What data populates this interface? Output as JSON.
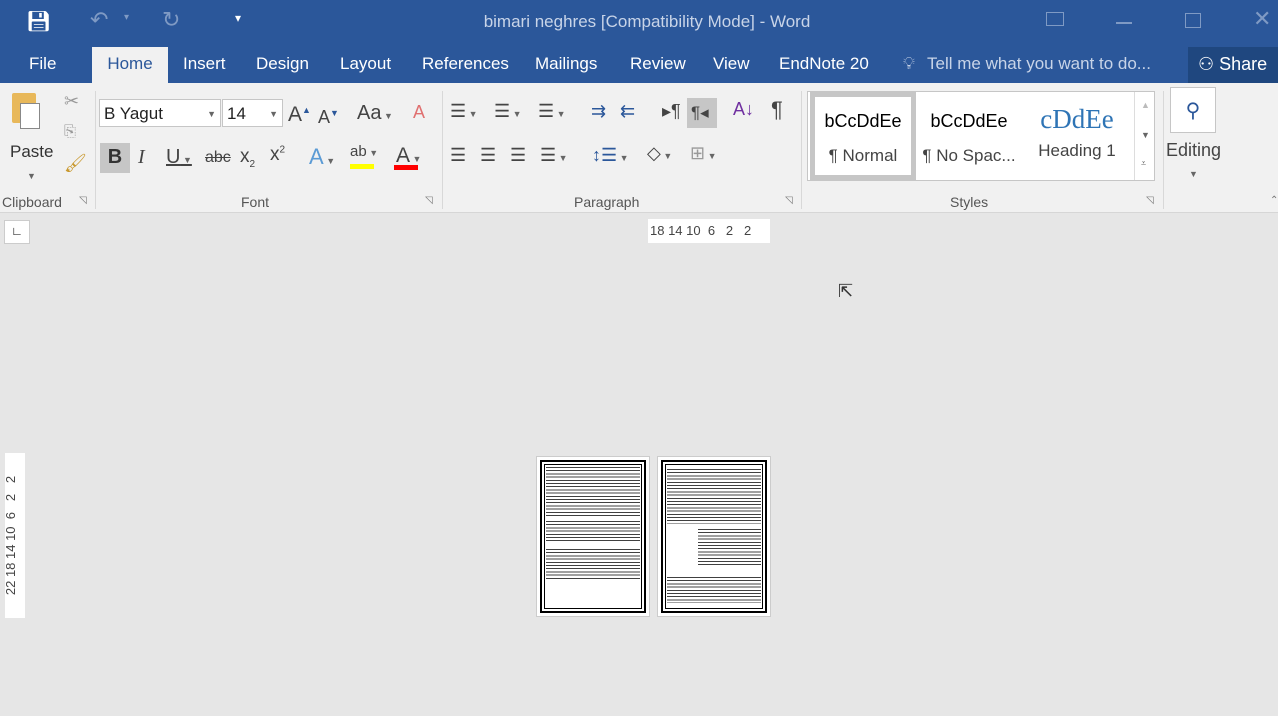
{
  "window": {
    "title": "bimari neghres [Compatibility Mode] - Word"
  },
  "quick_access": {
    "icons": [
      "save-icon",
      "undo-icon",
      "redo-icon",
      "customize-icon"
    ]
  },
  "window_controls": [
    "ribbon-display-icon",
    "minimize-icon",
    "maximize-icon",
    "close-icon"
  ],
  "tabs": [
    "File",
    "Home",
    "Insert",
    "Design",
    "Layout",
    "References",
    "Mailings",
    "Review",
    "View",
    "EndNote 20"
  ],
  "active_tab": "Home",
  "tell_me": {
    "placeholder": "Tell me what you want to do..."
  },
  "share": "Share",
  "clipboard": {
    "label": "Clipboard",
    "paste": "Paste"
  },
  "font": {
    "label": "Font",
    "name": "B Yagut",
    "size": "14",
    "change_case": "Aa",
    "highlight_color": "#ffff00",
    "font_color": "#ff0000"
  },
  "paragraph": {
    "label": "Paragraph"
  },
  "styles": {
    "label": "Styles",
    "items": [
      {
        "sample": "bCcDdEe",
        "name": "¶ Normal"
      },
      {
        "sample": "bCcDdEe",
        "name": "¶ No Spac..."
      },
      {
        "sample": "cDdEe",
        "name": "Heading 1"
      }
    ]
  },
  "editing": {
    "label": "Editing"
  },
  "ruler": {
    "horizontal": "18 14 10  6   2   2",
    "vertical": "22 18 14 10  6   2   2"
  },
  "colors": {
    "accent": "#2b579a",
    "background": "#e6e6e6"
  }
}
